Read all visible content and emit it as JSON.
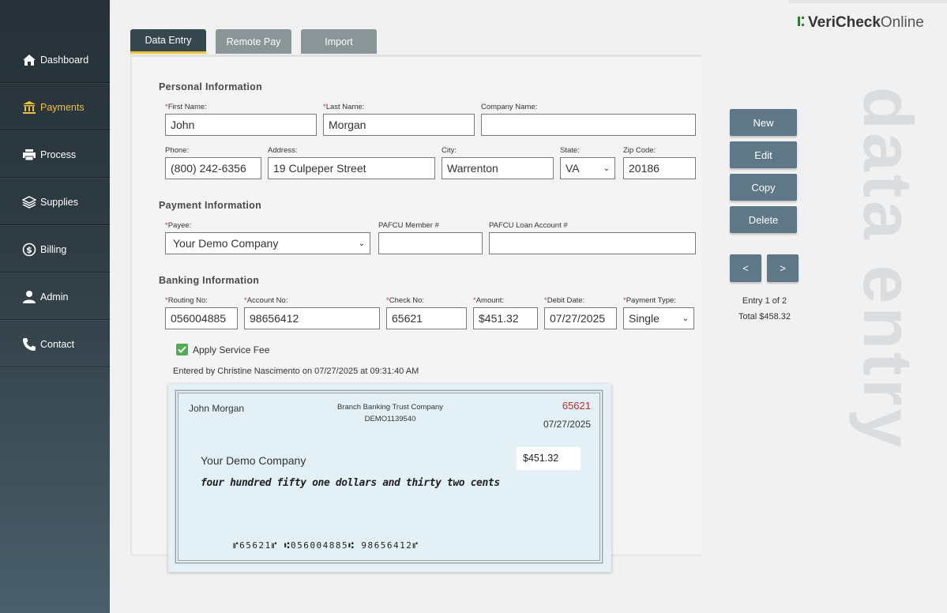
{
  "sidebar": {
    "items": [
      {
        "label": "Dashboard",
        "icon": "home-icon"
      },
      {
        "label": "Payments",
        "icon": "bank-icon"
      },
      {
        "label": "Process",
        "icon": "printer-icon"
      },
      {
        "label": "Supplies",
        "icon": "layers-icon"
      },
      {
        "label": "Billing",
        "icon": "dollar-circle-icon"
      },
      {
        "label": "Admin",
        "icon": "user-icon"
      },
      {
        "label": "Contact",
        "icon": "phone-icon"
      }
    ],
    "active": "Payments"
  },
  "logo": {
    "bold": "VeriCheck",
    "light": "Online"
  },
  "watermark": "data entry",
  "tabs": [
    {
      "label": "Data Entry",
      "active": true
    },
    {
      "label": "Remote Pay",
      "active": false
    },
    {
      "label": "Import",
      "active": false
    }
  ],
  "personal": {
    "title": "Personal Information",
    "first_name_label": "First Name:",
    "first_name": "John",
    "last_name_label": "Last Name:",
    "last_name": "Morgan",
    "company_label": "Company Name:",
    "company": "",
    "phone_label": "Phone:",
    "phone": "(800) 242-6356",
    "address_label": "Address:",
    "address": "19 Culpeper Street",
    "city_label": "City:",
    "city": "Warrenton",
    "state_label": "State:",
    "state": "VA",
    "zip_label": "Zip Code:",
    "zip": "20186"
  },
  "payment": {
    "title": "Payment Information",
    "payee_label": "Payee:",
    "payee": "Your Demo Company",
    "member_label": "PAFCU Member #",
    "member": "",
    "loan_label": "PAFCU Loan Account #",
    "loan": ""
  },
  "banking": {
    "title": "Banking Information",
    "routing_label": "Routing No:",
    "routing": "056004885",
    "account_label": "Account No:",
    "account": "98656412",
    "check_label": "Check No:",
    "check_no": "65621",
    "amount_label": "Amount:",
    "amount": "$451.32",
    "debit_label": "Debit Date:",
    "debit_date": "07/27/2025",
    "type_label": "Payment Type:",
    "type": "Single"
  },
  "service_fee": {
    "label": "Apply Service Fee",
    "checked": true
  },
  "entered_by": "Entered by Christine Nascimento on 07/27/2025 at 09:31:40 AM",
  "check": {
    "name": "John Morgan",
    "bank": "Branch Banking Trust Company",
    "bank_code": "DEMO1139540",
    "number": "65621",
    "date": "07/27/2025",
    "payee": "Your Demo Company",
    "amount": "$451.32",
    "written": "four hundred fifty one dollars and thirty two cents",
    "micr": "⑈65621⑈ ⑆056004885⑆ 98656412⑈",
    "number_color": "#c62828"
  },
  "actions": {
    "new": "New",
    "edit": "Edit",
    "copy": "Copy",
    "delete": "Delete",
    "prev": "<",
    "next": ">"
  },
  "entry": {
    "position": "Entry 1 of 2",
    "total": "Total $458.32"
  },
  "colors": {
    "accent": "#f2c230",
    "button": "#5e7887",
    "sidebar": "#263238",
    "logo_green": "#2e7d32"
  }
}
